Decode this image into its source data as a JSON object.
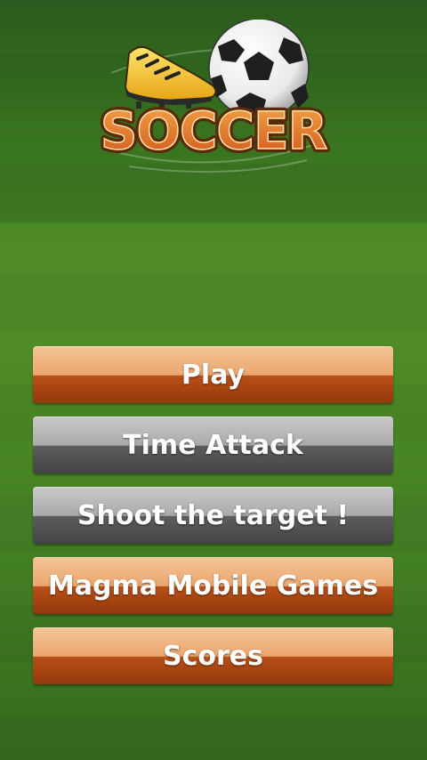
{
  "logo": {
    "title": "SOCCER",
    "icons": [
      "soccer-ball-icon",
      "football-boot-icon"
    ]
  },
  "menu": {
    "buttons": [
      {
        "label": "Play",
        "style": "orange"
      },
      {
        "label": "Time Attack",
        "style": "gray"
      },
      {
        "label": "Shoot the target !",
        "style": "gray"
      },
      {
        "label": "Magma Mobile Games",
        "style": "orange"
      },
      {
        "label": "Scores",
        "style": "orange"
      }
    ]
  },
  "colors": {
    "pitch_green": "#4f8c27",
    "button_orange": "#eba66e",
    "button_orange_dark": "#a4420f",
    "button_gray": "#a9a9a9",
    "button_gray_dark": "#4e4e4e",
    "logo_text": "#e8731f"
  }
}
